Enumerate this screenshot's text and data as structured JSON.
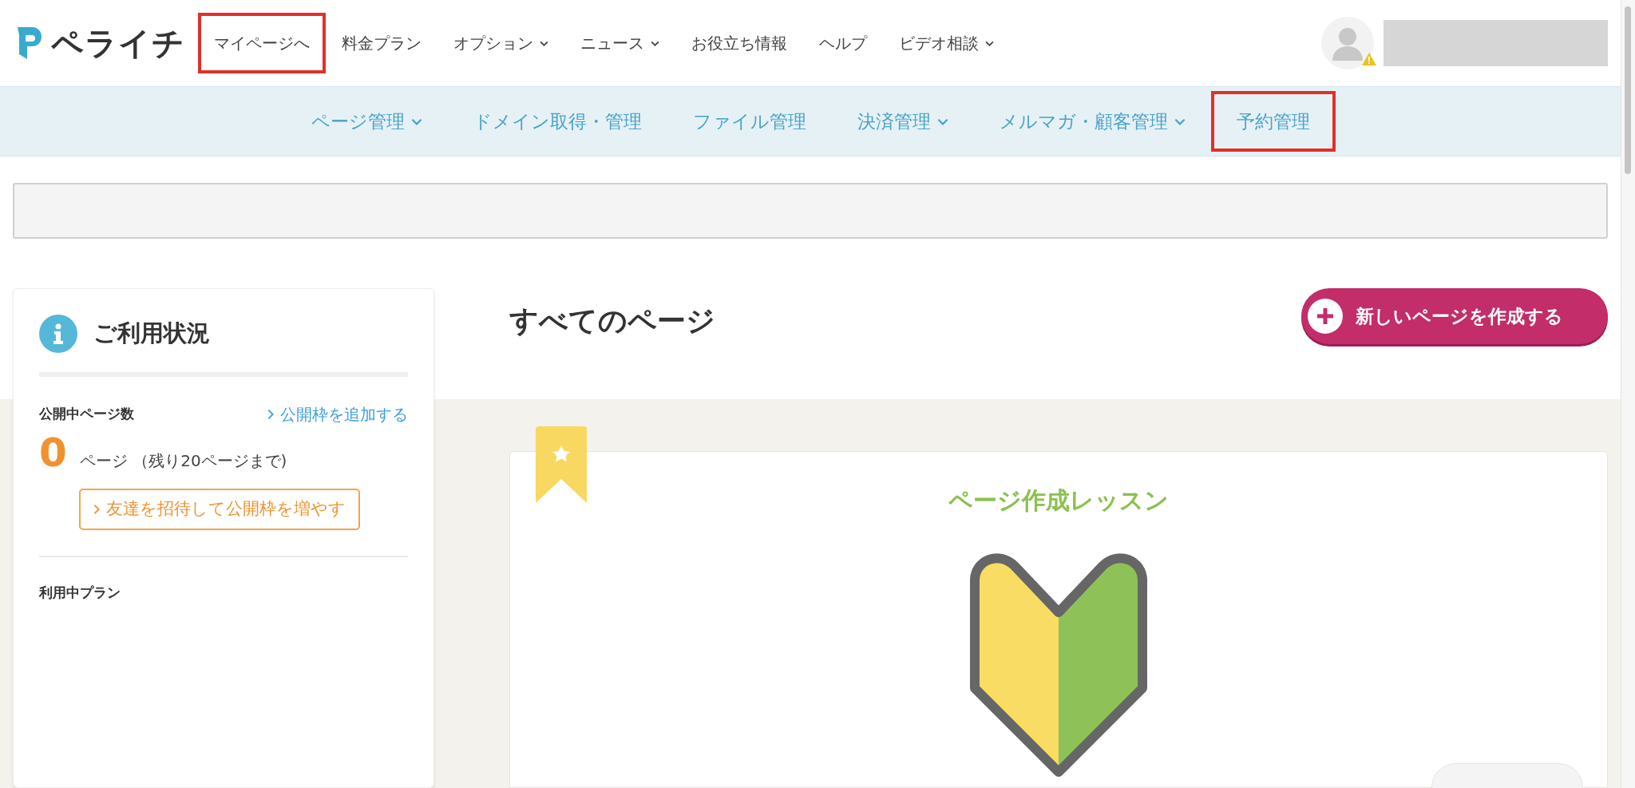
{
  "header": {
    "logo": "ペライチ",
    "nav": [
      {
        "label": "マイページへ",
        "dropdown": false,
        "highlighted": true
      },
      {
        "label": "料金プラン",
        "dropdown": false,
        "highlighted": false
      },
      {
        "label": "オプション",
        "dropdown": true,
        "highlighted": false
      },
      {
        "label": "ニュース",
        "dropdown": true,
        "highlighted": false
      },
      {
        "label": "お役立ち情報",
        "dropdown": false,
        "highlighted": false
      },
      {
        "label": "ヘルプ",
        "dropdown": false,
        "highlighted": false
      },
      {
        "label": "ビデオ相談",
        "dropdown": true,
        "highlighted": false
      }
    ]
  },
  "subnav": [
    {
      "label": "ページ管理",
      "dropdown": true,
      "highlighted": false
    },
    {
      "label": "ドメイン取得・管理",
      "dropdown": false,
      "highlighted": false
    },
    {
      "label": "ファイル管理",
      "dropdown": false,
      "highlighted": false
    },
    {
      "label": "決済管理",
      "dropdown": true,
      "highlighted": false
    },
    {
      "label": "メルマガ・顧客管理",
      "dropdown": true,
      "highlighted": false
    },
    {
      "label": "予約管理",
      "dropdown": false,
      "highlighted": true
    }
  ],
  "usage": {
    "title": "ご利用状況",
    "published_label": "公開中ページ数",
    "add_link": "公開枠を追加する",
    "count": "0",
    "count_text": "ページ （残り20ページまで)",
    "invite_button": "友達を招待して公開枠を増やす",
    "plan_label": "利用中プラン"
  },
  "main": {
    "title": "すべてのページ",
    "new_page_button": "新しいページを作成する",
    "lesson_title": "ページ作成レッスン"
  }
}
